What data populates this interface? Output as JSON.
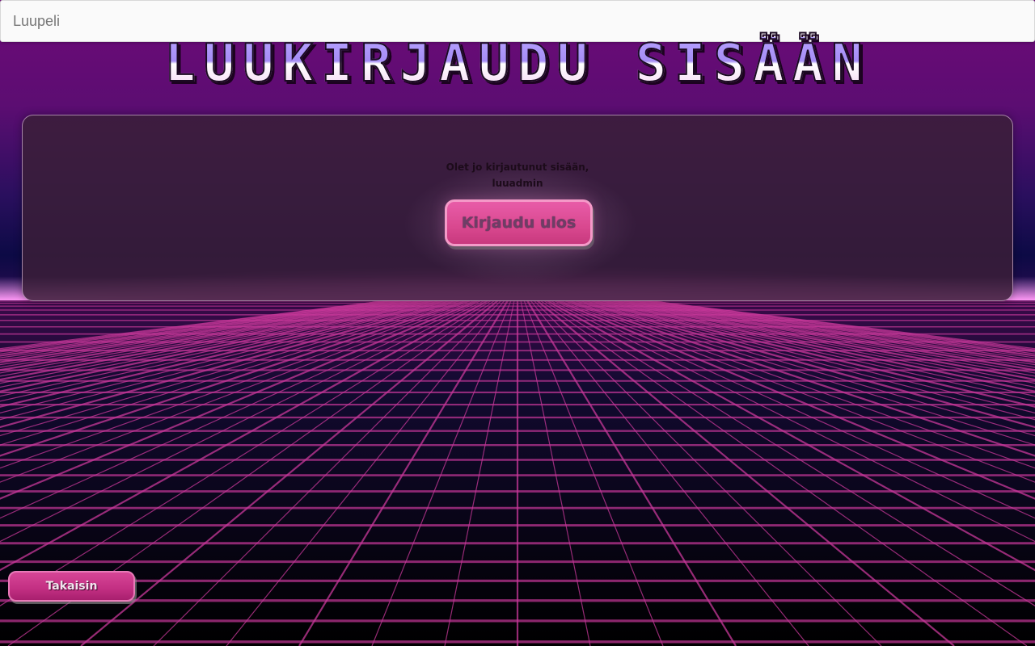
{
  "topbar": {
    "placeholder": "Luupeli"
  },
  "header": {
    "title": "LUUKIRJAUDU SISÄÄN"
  },
  "panel": {
    "status_line1": "Olet jo kirjautunut sisään,",
    "status_line2": "luuadmin",
    "logout_label": "Kirjaudu ulos"
  },
  "footer": {
    "back_label": "Takaisin"
  },
  "colors": {
    "sky_top": "#6e0a78",
    "horizon_glow": "#ff9df7",
    "grid_line": "#c8389a",
    "button_pink": "#d9488f"
  }
}
